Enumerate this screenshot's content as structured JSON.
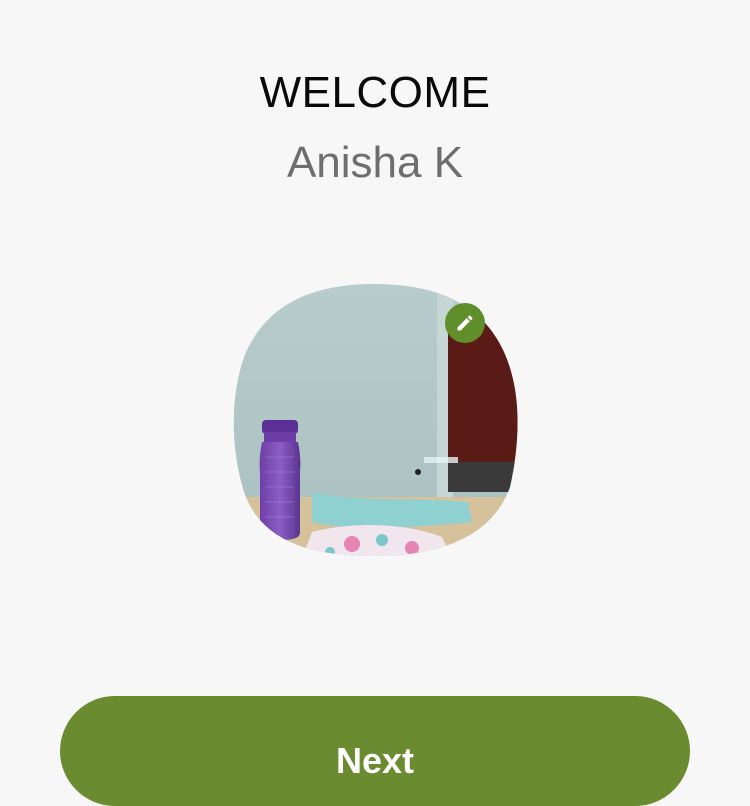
{
  "header": {
    "title": "WELCOME",
    "user_name": "Anisha K"
  },
  "profile": {
    "photo_icon": "profile-photo",
    "edit_icon": "pencil-icon"
  },
  "actions": {
    "next_label": "Next"
  },
  "colors": {
    "background": "#f7f7f7",
    "accent": "#6a8b2f",
    "edit_badge": "#5f8e2a",
    "title_text": "#0a0a0a",
    "subtitle_text": "#6e6e6e"
  }
}
